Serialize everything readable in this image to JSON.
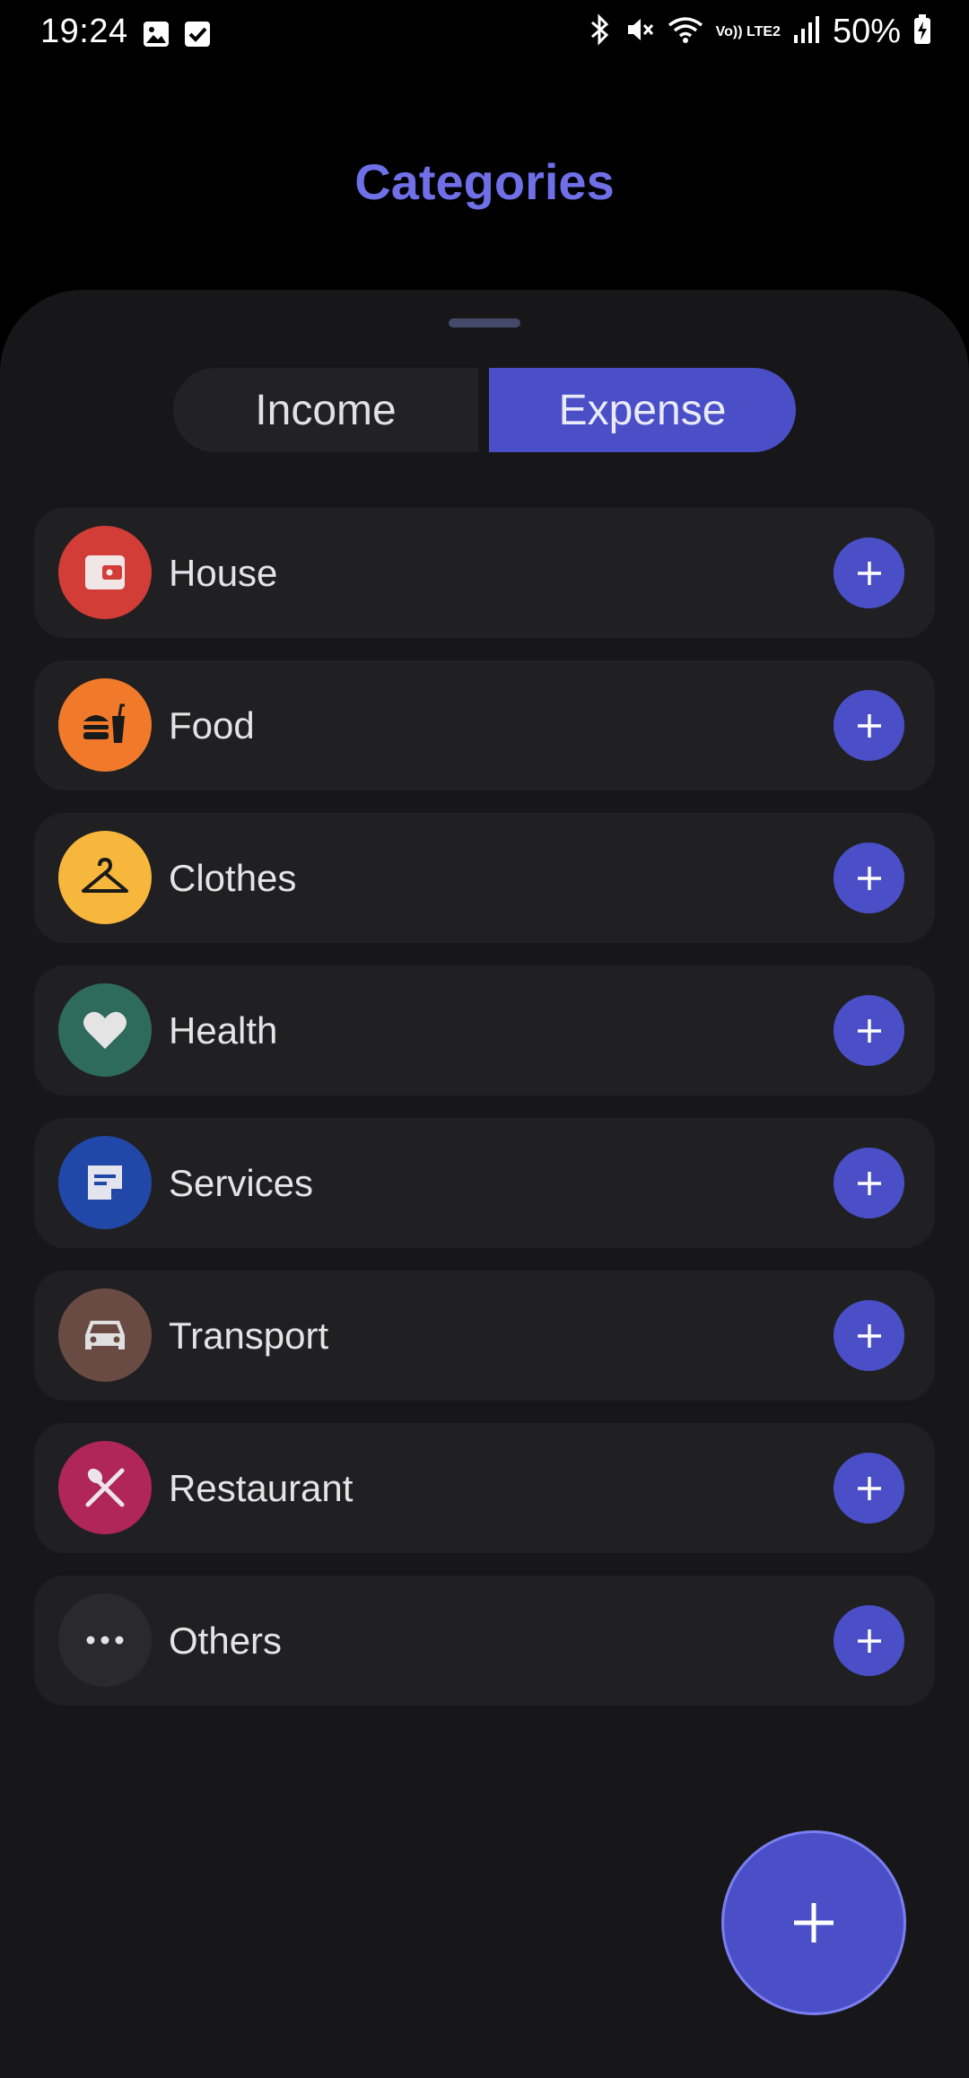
{
  "status_bar": {
    "time": "19:24",
    "battery": "50%",
    "left_icons": [
      "image-icon",
      "checkbox-icon"
    ],
    "right_icons": [
      "bluetooth-icon",
      "mute-icon",
      "wifi-icon",
      "volte-icon",
      "signal-icon",
      "battery-charging-icon"
    ],
    "volte_text": "Vo)) LTE2"
  },
  "header": {
    "title": "Categories"
  },
  "tabs": {
    "income_label": "Income",
    "expense_label": "Expense",
    "selected": "Expense"
  },
  "colors": {
    "accent": "#4a4fc8",
    "title": "#6f6fe8",
    "background": "#000000",
    "sheet": "#171719",
    "row": "#202022"
  },
  "categories": [
    {
      "label": "House",
      "icon": "wallet-icon",
      "color": "#d23d37"
    },
    {
      "label": "Food",
      "icon": "fastfood-icon",
      "color": "#f07a2a"
    },
    {
      "label": "Clothes",
      "icon": "hanger-icon",
      "color": "#f6b73c"
    },
    {
      "label": "Health",
      "icon": "heart-icon",
      "color": "#2f6b5c"
    },
    {
      "label": "Services",
      "icon": "note-icon",
      "color": "#2148a8"
    },
    {
      "label": "Transport",
      "icon": "car-icon",
      "color": "#6a4b44"
    },
    {
      "label": "Restaurant",
      "icon": "cutlery-icon",
      "color": "#b02657"
    },
    {
      "label": "Others",
      "icon": "more-icon",
      "color": "#2a2a2c"
    }
  ]
}
